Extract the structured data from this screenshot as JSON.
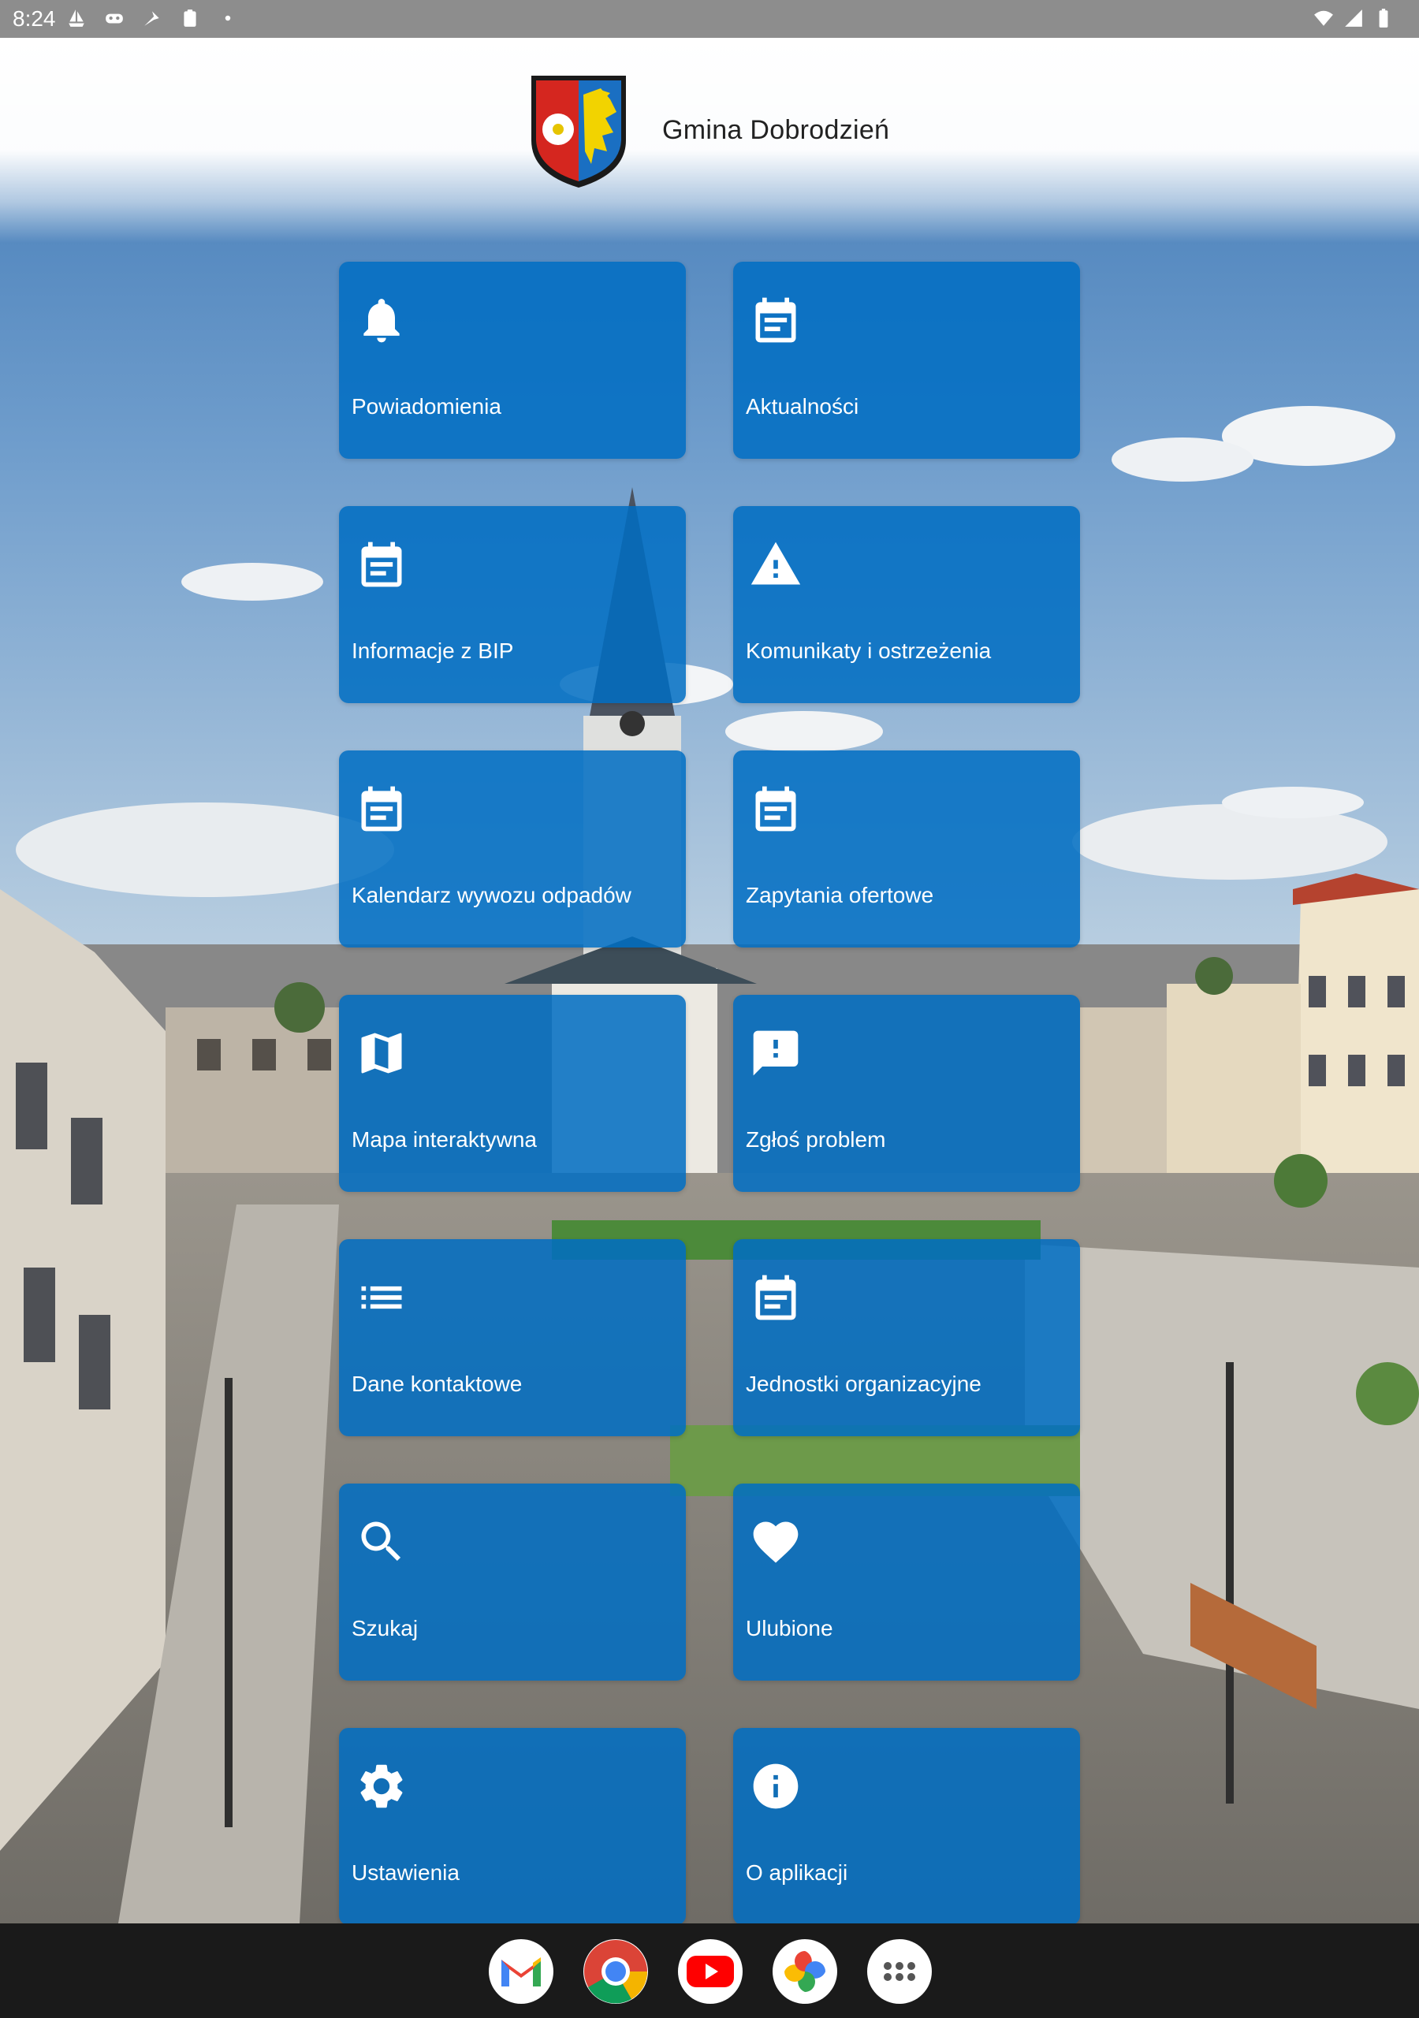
{
  "status_bar": {
    "time": "8:24"
  },
  "header": {
    "title": "Gmina Dobrodzień"
  },
  "tiles": [
    {
      "label": "Powiadomienia",
      "icon": "bell-icon"
    },
    {
      "label": "Aktualności",
      "icon": "calendar-icon"
    },
    {
      "label": "Informacje z BIP",
      "icon": "calendar-icon"
    },
    {
      "label": "Komunikaty i ostrzeżenia",
      "icon": "warning-icon"
    },
    {
      "label": "Kalendarz wywozu odpadów",
      "icon": "calendar-icon"
    },
    {
      "label": "Zapytania ofertowe",
      "icon": "calendar-icon"
    },
    {
      "label": "Mapa interaktywna",
      "icon": "map-icon"
    },
    {
      "label": "Zgłoś problem",
      "icon": "report-problem-icon"
    },
    {
      "label": "Dane kontaktowe",
      "icon": "list-icon"
    },
    {
      "label": "Jednostki organizacyjne",
      "icon": "calendar-icon"
    },
    {
      "label": "Szukaj",
      "icon": "search-icon"
    },
    {
      "label": "Ulubione",
      "icon": "heart-icon"
    },
    {
      "label": "Ustawienia",
      "icon": "gear-icon"
    },
    {
      "label": "O aplikacji",
      "icon": "info-icon"
    }
  ],
  "dock": {
    "apps": [
      "gmail-icon",
      "chrome-icon",
      "youtube-icon",
      "photos-icon",
      "app-drawer-icon"
    ]
  },
  "colors": {
    "tile": "#006ec3",
    "status_bar": "#8d8d8d",
    "dock": "#1a1a1a"
  }
}
